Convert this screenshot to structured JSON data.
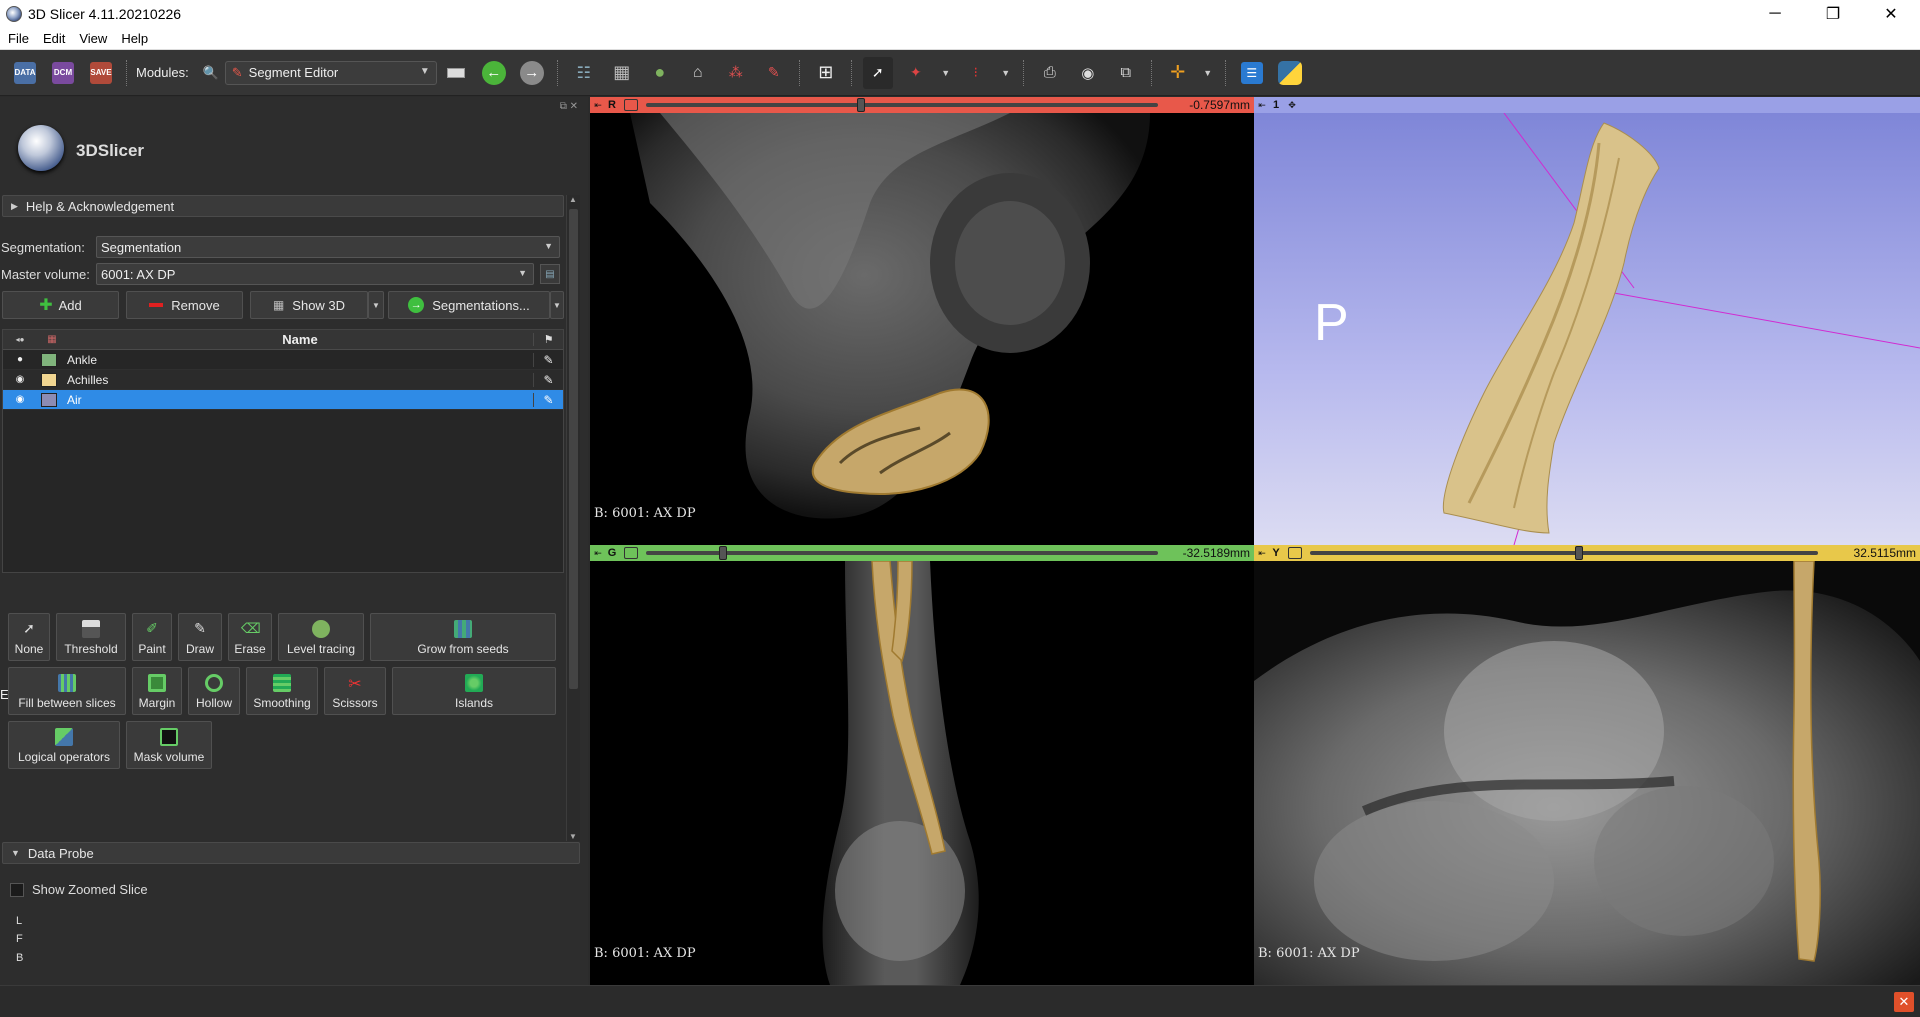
{
  "window": {
    "title": "3D Slicer 4.11.20210226",
    "minimize": "─",
    "restore": "❐",
    "close": "✕"
  },
  "menu": [
    "File",
    "Edit",
    "View",
    "Help"
  ],
  "toolbar": {
    "data_label": "DATA",
    "dcm_label": "DCM",
    "save_label": "SAVE",
    "modules_label": "Modules:",
    "module_selected": "Segment Editor"
  },
  "left_panel": {
    "logo_text": "3DSlicer",
    "undock": "⧉ ✕",
    "help_section": "Help & Acknowledgement",
    "segmentation_label": "Segmentation:",
    "segmentation_value": "Segmentation",
    "master_volume_label": "Master volume:",
    "master_volume_value": "6001: AX DP",
    "buttons": {
      "add": "Add",
      "remove": "Remove",
      "show3d": "Show 3D",
      "segmentations": "Segmentations..."
    },
    "table": {
      "name_header": "Name",
      "rows": [
        {
          "name": "Ankle",
          "color": "#80b47c"
        },
        {
          "name": "Achilles",
          "color": "#f1d691"
        },
        {
          "name": "Air",
          "color": "#8c8cb4"
        }
      ]
    },
    "effects_label": "Effects",
    "effects": {
      "none": "None",
      "threshold": "Threshold",
      "paint": "Paint",
      "draw": "Draw",
      "erase": "Erase",
      "level_tracing": "Level tracing",
      "grow_from_seeds": "Grow from seeds",
      "fill_between_slices": "Fill between slices",
      "margin": "Margin",
      "hollow": "Hollow",
      "smoothing": "Smoothing",
      "scissors": "Scissors",
      "islands": "Islands",
      "logical_operators": "Logical operators",
      "mask_volume": "Mask volume"
    },
    "data_probe": "Data Probe",
    "show_zoomed_slice": "Show Zoomed Slice",
    "probe_lines": [
      "L",
      "F",
      "B"
    ]
  },
  "views": {
    "red": {
      "label": "R",
      "offset": "-0.7597mm",
      "corner": "B: 6001: AX DP",
      "color": "#e8584a",
      "slider": 0.42
    },
    "threed": {
      "label": "1",
      "orientation": "P",
      "color": "#9aa0e6"
    },
    "green": {
      "label": "G",
      "offset": "-32.5189mm",
      "corner": "B: 6001: AX DP",
      "color": "#6ec25a",
      "slider": 0.15
    },
    "yellow": {
      "label": "Y",
      "offset": "32.5115mm",
      "corner": "B: 6001: AX DP",
      "color": "#e8c84a",
      "slider": 0.53
    }
  }
}
